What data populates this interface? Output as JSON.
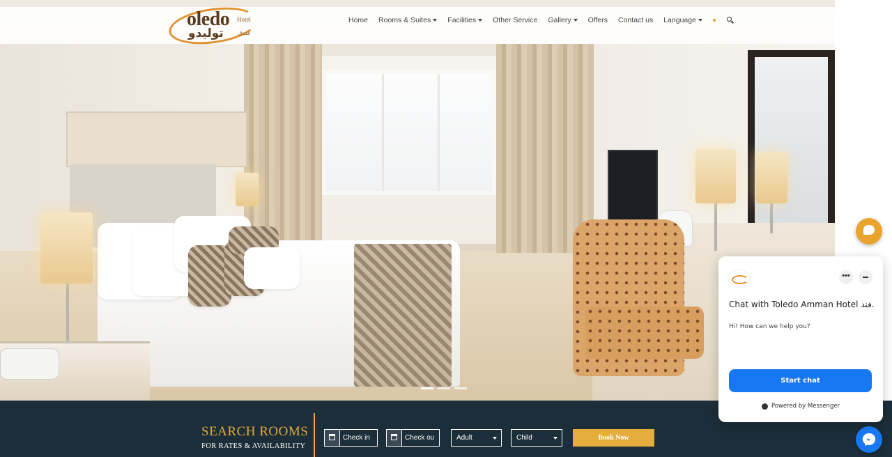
{
  "brand": {
    "logo_name": "oledo",
    "logo_hotel": "Hotel",
    "logo_arabic": "توليدو",
    "logo_arabic_small": "فندق"
  },
  "nav": {
    "items": [
      {
        "label": "Home",
        "has_dropdown": false
      },
      {
        "label": "Rooms & Suites",
        "has_dropdown": true
      },
      {
        "label": "Facilities",
        "has_dropdown": true
      },
      {
        "label": "Other Service",
        "has_dropdown": false
      },
      {
        "label": "Gallery",
        "has_dropdown": true
      },
      {
        "label": "Offers",
        "has_dropdown": false
      },
      {
        "label": "Contact us",
        "has_dropdown": false
      },
      {
        "label": "Language",
        "has_dropdown": true
      }
    ],
    "search_icon": "search-icon"
  },
  "hero": {
    "slides_count": 3,
    "active_slide": 1
  },
  "booking": {
    "title": "SEARCH ROOMS",
    "subtitle": "FOR RATES & AVAILABILITY",
    "check_in_placeholder": "Check in",
    "check_out_placeholder": "Check ou",
    "adult_selected": "Adult",
    "child_selected": "Child",
    "book_label": "Book Now"
  },
  "chat": {
    "title": "Chat with Toledo Amman Hotel فند...",
    "greeting": "Hi! How can we help you?",
    "start_label": "Start chat",
    "more_label": "•••",
    "powered_label": "Powered by Messenger"
  },
  "colors": {
    "accent_gold": "#e4ad3d",
    "booking_bg": "#1c2e39",
    "messenger_blue": "#1877f2"
  }
}
